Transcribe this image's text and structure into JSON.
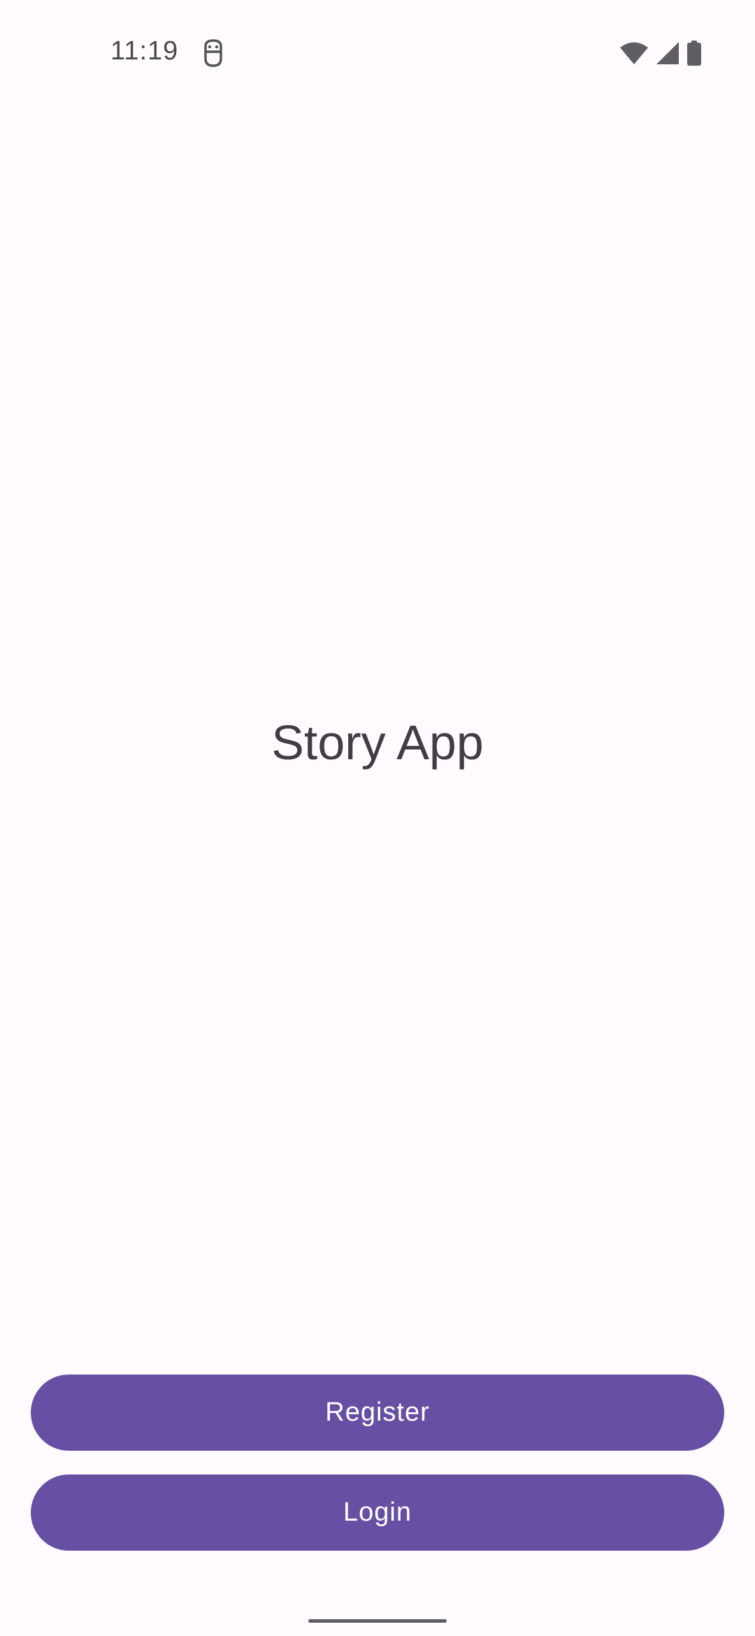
{
  "status_bar": {
    "time": "11:19",
    "app_icon": "android-debug-icon",
    "icons": [
      "wifi-icon",
      "cellular-signal-icon",
      "battery-icon"
    ]
  },
  "main": {
    "title": "Story App"
  },
  "actions": {
    "register_label": "Register",
    "login_label": "Login"
  },
  "colors": {
    "background": "#fffbfe",
    "primary": "#6750a4",
    "on_primary": "#ffffff",
    "title_text": "#403d45"
  }
}
